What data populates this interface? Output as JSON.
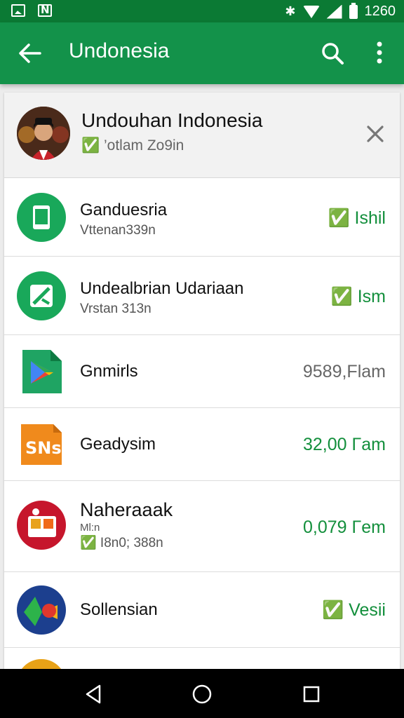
{
  "status_bar": {
    "time": "1260",
    "bluetooth_icon": "bluetooth-icon"
  },
  "app_bar": {
    "title": "Undonesia",
    "back_icon": "arrow-back-icon",
    "search_icon": "search-icon",
    "more_icon": "more-vert-icon"
  },
  "header": {
    "title": "Undouhan Indonesia",
    "subtitle": "✅ ’otlam Zo9in"
  },
  "apps": [
    {
      "name": "Ganduesria",
      "sub": "Vttenan339n",
      "action": "✅ Ishil",
      "action_color": "#138f3c",
      "icon": "phone-app-icon"
    },
    {
      "name": "Undealbrian  Udariaan",
      "sub": "Vrstan 313n",
      "action": "✅ Ism",
      "action_color": "#138f3c",
      "icon": "edit-app-icon"
    },
    {
      "name": "Gnmirls",
      "sub": "",
      "action": "9589,Flam",
      "action_color": "#666666",
      "icon": "play-store-icon"
    },
    {
      "name": "Geadysim",
      "sub": "",
      "action": "32,00 Γam",
      "action_color": "#138f3c",
      "icon": "sns-app-icon"
    },
    {
      "name": "Naheraaak",
      "sub": "✅ I8n0; 388n",
      "small": "Ml:n",
      "action": "0,079 Γem",
      "action_color": "#138f3c",
      "icon": "news-app-icon"
    },
    {
      "name": "Sollensian",
      "sub": "",
      "action": "✅ Vesii",
      "action_color": "#138f3c",
      "icon": "maps-app-icon"
    }
  ],
  "colors": {
    "status_bar": "#0b7a34",
    "app_bar": "#13924a",
    "accent_green": "#138f3c"
  }
}
